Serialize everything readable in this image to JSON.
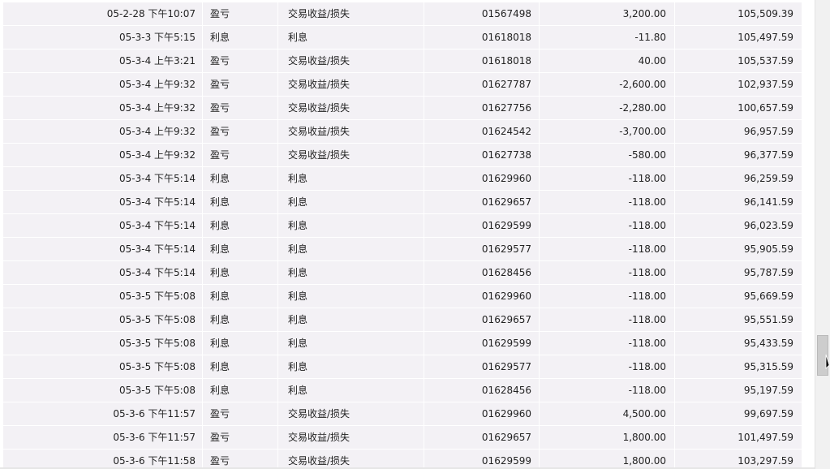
{
  "transactions": [
    {
      "date": "05-2-28 下午10:07",
      "type": "盈亏",
      "description": "交易收益/损失",
      "ticket": "01567498",
      "amount": "3,200.00",
      "balance": "105,509.39"
    },
    {
      "date": "05-3-3 下午5:15",
      "type": "利息",
      "description": "利息",
      "ticket": "01618018",
      "amount": "-11.80",
      "balance": "105,497.59"
    },
    {
      "date": "05-3-4 上午3:21",
      "type": "盈亏",
      "description": "交易收益/损失",
      "ticket": "01618018",
      "amount": "40.00",
      "balance": "105,537.59"
    },
    {
      "date": "05-3-4 上午9:32",
      "type": "盈亏",
      "description": "交易收益/损失",
      "ticket": "01627787",
      "amount": "-2,600.00",
      "balance": "102,937.59"
    },
    {
      "date": "05-3-4 上午9:32",
      "type": "盈亏",
      "description": "交易收益/损失",
      "ticket": "01627756",
      "amount": "-2,280.00",
      "balance": "100,657.59"
    },
    {
      "date": "05-3-4 上午9:32",
      "type": "盈亏",
      "description": "交易收益/损失",
      "ticket": "01624542",
      "amount": "-3,700.00",
      "balance": "96,957.59"
    },
    {
      "date": "05-3-4 上午9:32",
      "type": "盈亏",
      "description": "交易收益/损失",
      "ticket": "01627738",
      "amount": "-580.00",
      "balance": "96,377.59"
    },
    {
      "date": "05-3-4 下午5:14",
      "type": "利息",
      "description": "利息",
      "ticket": "01629960",
      "amount": "-118.00",
      "balance": "96,259.59"
    },
    {
      "date": "05-3-4 下午5:14",
      "type": "利息",
      "description": "利息",
      "ticket": "01629657",
      "amount": "-118.00",
      "balance": "96,141.59"
    },
    {
      "date": "05-3-4 下午5:14",
      "type": "利息",
      "description": "利息",
      "ticket": "01629599",
      "amount": "-118.00",
      "balance": "96,023.59"
    },
    {
      "date": "05-3-4 下午5:14",
      "type": "利息",
      "description": "利息",
      "ticket": "01629577",
      "amount": "-118.00",
      "balance": "95,905.59"
    },
    {
      "date": "05-3-4 下午5:14",
      "type": "利息",
      "description": "利息",
      "ticket": "01628456",
      "amount": "-118.00",
      "balance": "95,787.59"
    },
    {
      "date": "05-3-5 下午5:08",
      "type": "利息",
      "description": "利息",
      "ticket": "01629960",
      "amount": "-118.00",
      "balance": "95,669.59"
    },
    {
      "date": "05-3-5 下午5:08",
      "type": "利息",
      "description": "利息",
      "ticket": "01629657",
      "amount": "-118.00",
      "balance": "95,551.59"
    },
    {
      "date": "05-3-5 下午5:08",
      "type": "利息",
      "description": "利息",
      "ticket": "01629599",
      "amount": "-118.00",
      "balance": "95,433.59"
    },
    {
      "date": "05-3-5 下午5:08",
      "type": "利息",
      "description": "利息",
      "ticket": "01629577",
      "amount": "-118.00",
      "balance": "95,315.59"
    },
    {
      "date": "05-3-5 下午5:08",
      "type": "利息",
      "description": "利息",
      "ticket": "01628456",
      "amount": "-118.00",
      "balance": "95,197.59"
    },
    {
      "date": "05-3-6 下午11:57",
      "type": "盈亏",
      "description": "交易收益/损失",
      "ticket": "01629960",
      "amount": "4,500.00",
      "balance": "99,697.59"
    },
    {
      "date": "05-3-6 下午11:57",
      "type": "盈亏",
      "description": "交易收益/损失",
      "ticket": "01629657",
      "amount": "1,800.00",
      "balance": "101,497.59"
    },
    {
      "date": "05-3-6 下午11:58",
      "type": "盈亏",
      "description": "交易收益/损失",
      "ticket": "01629599",
      "amount": "1,800.00",
      "balance": "103,297.59"
    }
  ],
  "scrollbar": {
    "position": 0.85
  },
  "colors": {
    "row_background": "#f3f1f5",
    "grid_line": "#ffffff",
    "text": "#222222"
  }
}
